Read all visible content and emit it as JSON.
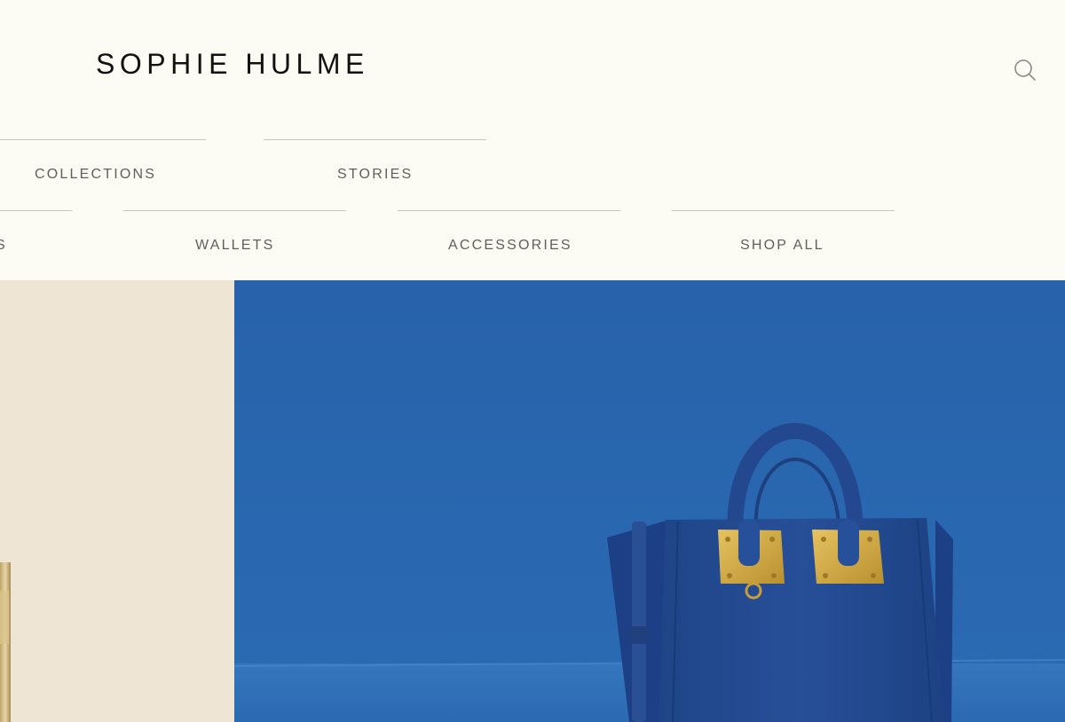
{
  "brand": {
    "logo_text": "SOPHIE HULME"
  },
  "header": {
    "search_icon": "search-icon"
  },
  "nav": {
    "row1": [
      {
        "label": "COLLECTIONS"
      },
      {
        "label": "STORIES"
      }
    ],
    "row2": [
      {
        "label": "S"
      },
      {
        "label": "WALLETS"
      },
      {
        "label": "ACCESSORIES"
      },
      {
        "label": "SHOP ALL"
      }
    ]
  },
  "colors": {
    "page_background": "#fdfcf4",
    "nav_text": "#5f5f5a",
    "rule": "#c7c6bd",
    "hero_left_background": "#efe5d5",
    "hero_right_background": "#2a68af",
    "bag": "#224a90",
    "hardware_gold": "#d8b14a"
  }
}
